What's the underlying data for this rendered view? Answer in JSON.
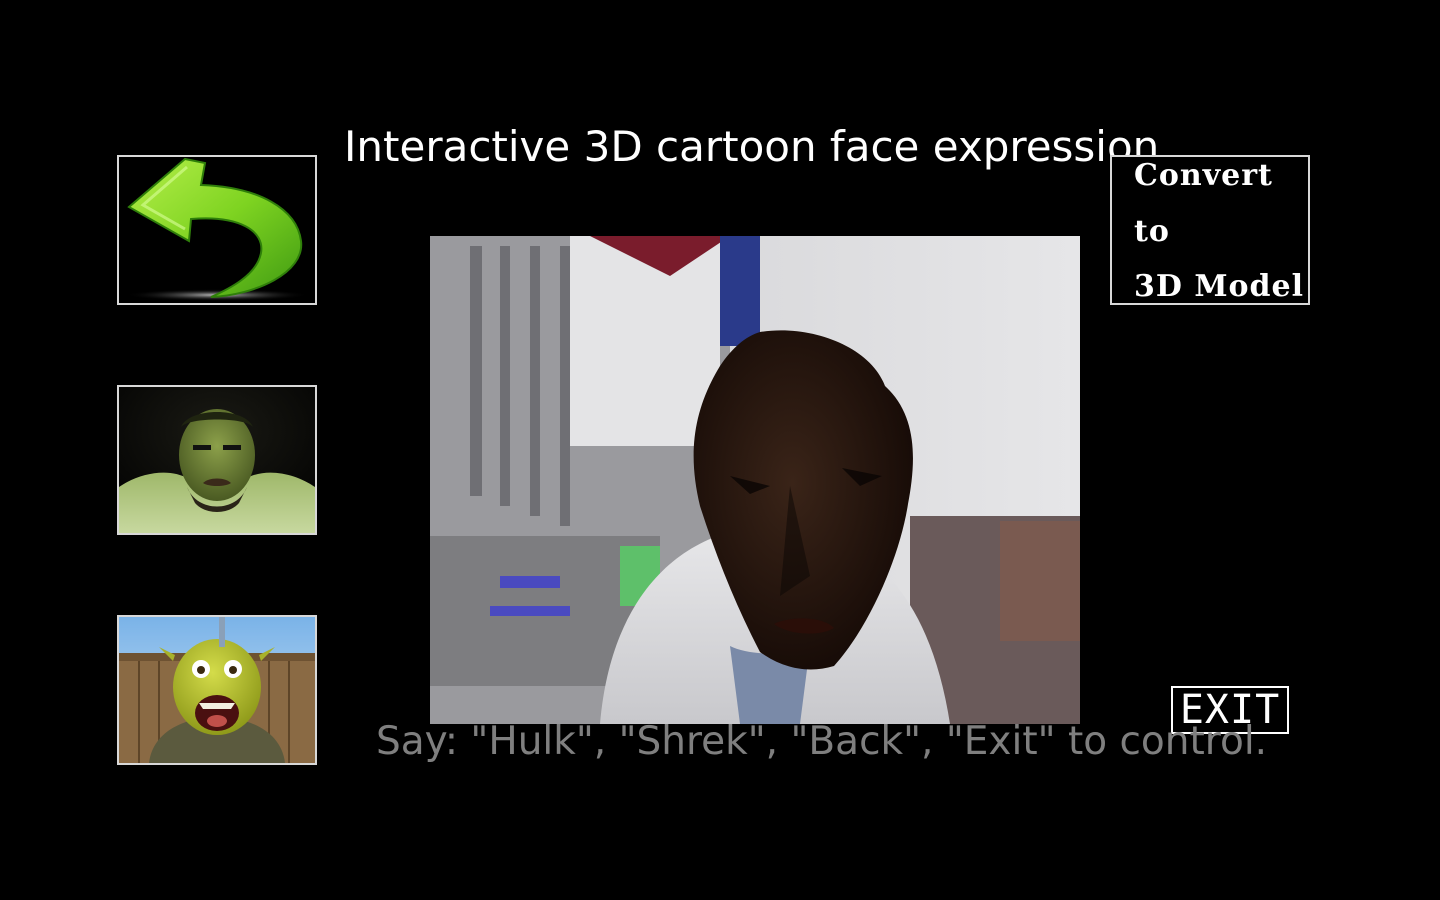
{
  "app": {
    "title": "Interactive 3D cartoon face expression"
  },
  "buttons": {
    "back": {
      "icon": "back-arrow-icon"
    },
    "hulk": {
      "image": "hulk-face-image"
    },
    "shrek": {
      "image": "shrek-face-image"
    },
    "convert": {
      "line1": "Convert",
      "line2": "to",
      "line3": "3D Model"
    },
    "exit": {
      "label": "EXIT"
    }
  },
  "hint": {
    "text": "Say: \"Hulk\", \"Shrek\", \"Back\", \"Exit\" to control."
  },
  "colors": {
    "background": "#000000",
    "title": "#ffffff",
    "hint": "#7f7f7f",
    "arrow_green": "#7ed321"
  }
}
